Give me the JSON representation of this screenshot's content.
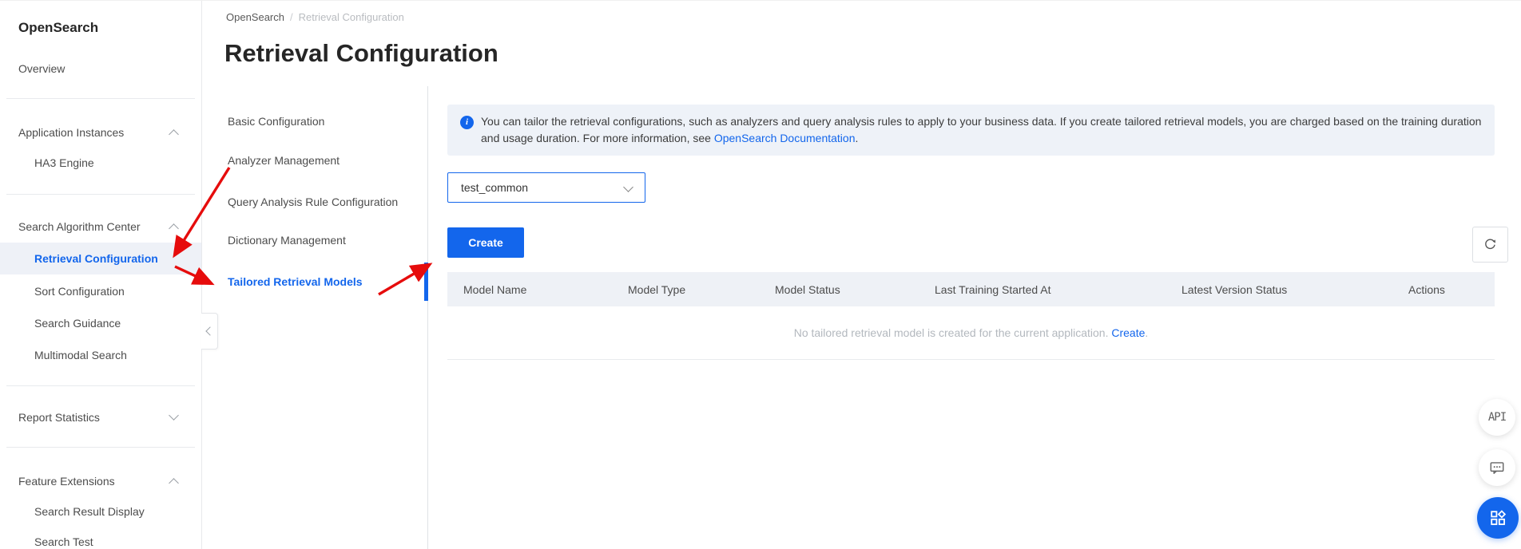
{
  "colors": {
    "accent": "#1366ec",
    "arrow_red": "#e60c0c",
    "banner_bg": "#eef2f8",
    "table_head_bg": "#eef1f6"
  },
  "sidebar": {
    "title": "OpenSearch",
    "overview": "Overview",
    "app_instances": "Application Instances",
    "ha3_engine": "HA3 Engine",
    "search_algorithm_center": "Search Algorithm Center",
    "retrieval_configuration": "Retrieval Configuration",
    "sort_configuration": "Sort Configuration",
    "search_guidance": "Search Guidance",
    "multimodal_search": "Multimodal Search",
    "report_statistics": "Report Statistics",
    "feature_extensions": "Feature Extensions",
    "search_result_display": "Search Result Display",
    "search_test": "Search Test"
  },
  "breadcrumb": {
    "root": "OpenSearch",
    "separator": "/",
    "current": "Retrieval Configuration"
  },
  "page": {
    "title": "Retrieval Configuration"
  },
  "subnav": {
    "items": [
      "Basic Configuration",
      "Analyzer Management",
      "Query Analysis Rule Configuration",
      "Dictionary Management",
      "Tailored Retrieval Models"
    ]
  },
  "banner": {
    "text_before_link": "You can tailor the retrieval configurations, such as analyzers and query analysis rules to apply to your business data. If you create tailored retrieval models, you are charged based on the training duration and usage duration. For more information, see ",
    "link": "OpenSearch Documentation",
    "text_after_link": "."
  },
  "toolbar": {
    "app_select_value": "test_common",
    "create_label": "Create"
  },
  "table": {
    "headers": [
      "Model Name",
      "Model Type",
      "Model Status",
      "Last Training Started At",
      "Latest Version Status",
      "Actions"
    ],
    "rows": [],
    "empty_text": "No tailored retrieval model is created for the current application. ",
    "empty_link": "Create",
    "empty_suffix": "."
  },
  "floating": {
    "api_label": "API"
  }
}
